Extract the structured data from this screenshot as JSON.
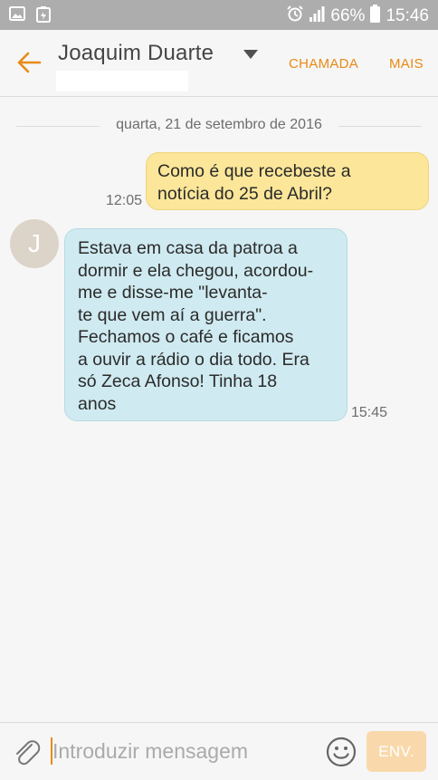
{
  "status_bar": {
    "battery": "66%",
    "time": "15:46",
    "icons": [
      "image-icon",
      "battery-saver-icon",
      "alarm-icon",
      "signal-icon",
      "battery-icon"
    ]
  },
  "header": {
    "contact_name": "Joaquim Duarte",
    "call_label": "CHAMADA",
    "more_label": "MAIS",
    "accent_color": "#e88a16"
  },
  "conversation": {
    "date": "quarta, 21 de setembro de 2016",
    "messages": [
      {
        "direction": "outgoing",
        "lines": [
          "Como é que recebeste a",
          "notícia do 25 de Abril?"
        ],
        "time": "12:05",
        "bubble_color": "#fbe699"
      },
      {
        "direction": "incoming",
        "avatar_letter": "J",
        "lines": [
          "Estava em casa da patroa a",
          "dormir e ela chegou, acordou-",
          "me e disse-me \"levanta-",
          "te que vem aí a guerra\".",
          "Fechamos o café e ficamos",
          "a ouvir a rádio o dia todo. Era",
          "só Zeca Afonso! Tinha 18",
          "anos"
        ],
        "time": "15:45",
        "bubble_color": "#cfeaf0"
      }
    ]
  },
  "composer": {
    "placeholder": "Introduzir mensagem",
    "value": "",
    "send_label": "ENV."
  }
}
